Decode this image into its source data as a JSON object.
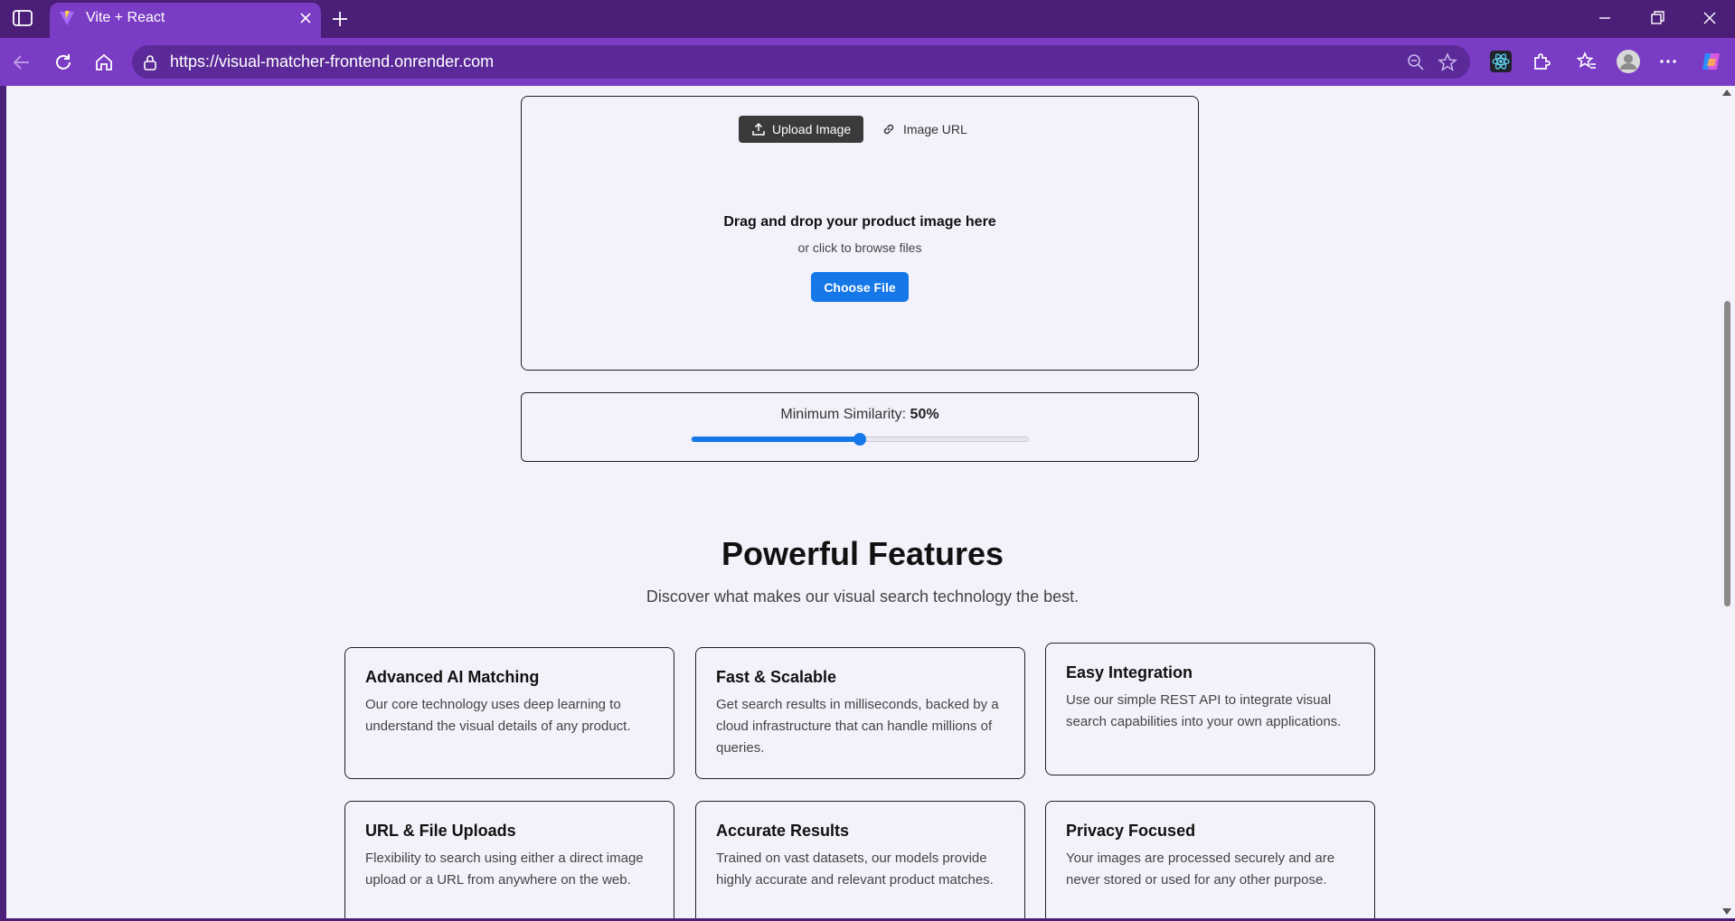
{
  "browser": {
    "tab_title": "Vite + React",
    "url": "https://visual-matcher-frontend.onrender.com",
    "accent_color": "#7a3cc4",
    "frame_color": "#4b1f77"
  },
  "upload": {
    "tab_upload_label": "Upload Image",
    "tab_url_label": "Image URL",
    "drop_title": "Drag and drop your product image here",
    "drop_subtitle": "or click to browse files",
    "choose_file_label": "Choose File"
  },
  "similarity": {
    "label": "Minimum Similarity: ",
    "value_text": "50%",
    "value": 0.5
  },
  "features": {
    "title": "Powerful Features",
    "subtitle": "Discover what makes our visual search technology the best.",
    "items": [
      {
        "title": "Advanced AI Matching",
        "description": "Our core technology uses deep learning to understand the visual details of any product."
      },
      {
        "title": "Fast & Scalable",
        "description": "Get search results in milliseconds, backed by a cloud infrastructure that can handle millions of queries."
      },
      {
        "title": "Easy Integration",
        "description": "Use our simple REST API to integrate visual search capabilities into your own applications."
      },
      {
        "title": "URL & File Uploads",
        "description": "Flexibility to search using either a direct image upload or a URL from anywhere on the web."
      },
      {
        "title": "Accurate Results",
        "description": "Trained on vast datasets, our models provide highly accurate and relevant product matches."
      },
      {
        "title": "Privacy Focused",
        "description": "Your images are processed securely and are never stored or used for any other purpose."
      }
    ]
  }
}
